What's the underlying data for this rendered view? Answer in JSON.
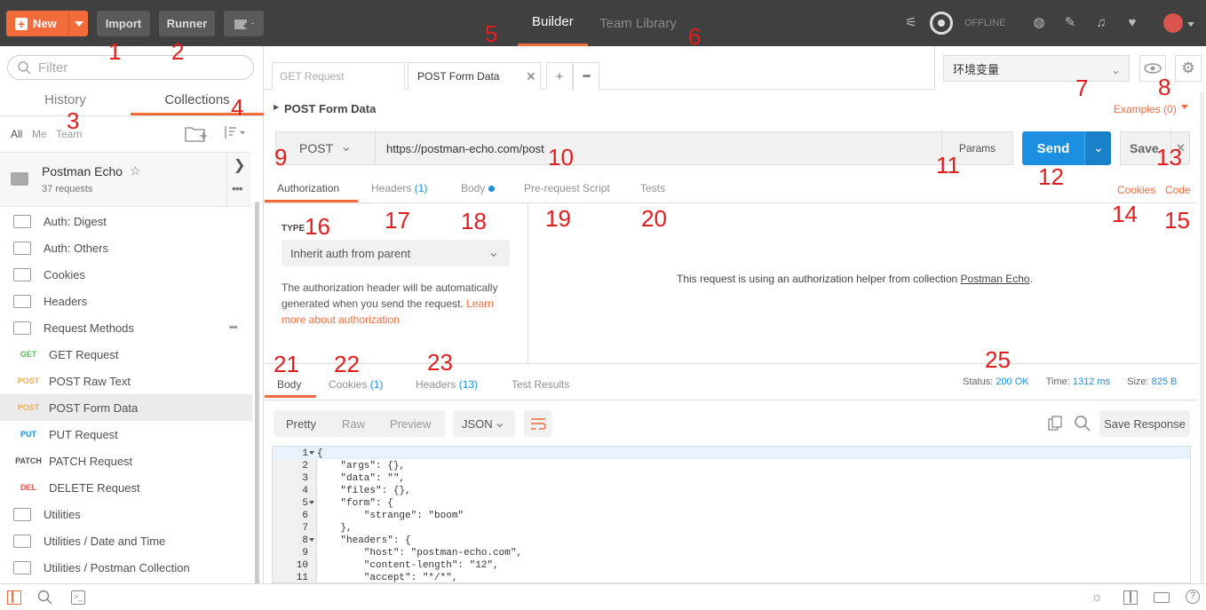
{
  "topbar": {
    "new_label": "New",
    "import_label": "Import",
    "runner_label": "Runner",
    "tabs": [
      "Builder",
      "Team Library"
    ],
    "offline_label": "OFFLINE"
  },
  "sidebar": {
    "filter_placeholder": "Filter",
    "tabs": [
      "History",
      "Collections"
    ],
    "filters": [
      "All",
      "Me",
      "Team"
    ],
    "collection": {
      "name": "Postman Echo",
      "count": "37 requests"
    },
    "items": [
      {
        "type": "folder",
        "label": "Auth: Digest"
      },
      {
        "type": "folder",
        "label": "Auth: Others"
      },
      {
        "type": "folder",
        "label": "Cookies"
      },
      {
        "type": "folder",
        "label": "Headers"
      },
      {
        "type": "folder-open",
        "label": "Request Methods"
      },
      {
        "type": "request",
        "method": "GET",
        "method_color": "#5cb85c",
        "label": "GET Request"
      },
      {
        "type": "request",
        "method": "POST",
        "method_color": "#f0ad4e",
        "label": "POST Raw Text"
      },
      {
        "type": "request",
        "method": "POST",
        "method_color": "#f0ad4e",
        "label": "POST Form Data"
      },
      {
        "type": "request",
        "method": "PUT",
        "method_color": "#1d8fe0",
        "label": "PUT Request"
      },
      {
        "type": "request",
        "method": "PATCH",
        "method_color": "#505050",
        "label": "PATCH Request"
      },
      {
        "type": "request",
        "method": "DEL",
        "method_color": "#d9534f",
        "label": "DELETE Request"
      },
      {
        "type": "folder",
        "label": "Utilities"
      },
      {
        "type": "folder",
        "label": "Utilities / Date and Time"
      },
      {
        "type": "folder",
        "label": "Utilities / Postman Collection"
      }
    ]
  },
  "request_tabs": [
    "GET Request",
    "POST Form Data"
  ],
  "environment": "环境变量",
  "request": {
    "name": "POST Form Data",
    "examples": "Examples (0)",
    "method": "POST",
    "url": "https://postman-echo.com/post",
    "params_label": "Params",
    "send_label": "Send",
    "save_label": "Save",
    "subtabs": [
      "Authorization",
      "Headers",
      "(1)",
      "Body",
      "Pre-request Script",
      "Tests"
    ],
    "cookies_link": "Cookies",
    "code_link": "Code"
  },
  "auth": {
    "type_label": "TYPE",
    "type_value": "Inherit auth from parent",
    "description": "The authorization header will be automatically generated when you send the request.",
    "learn_more": "Learn more about authorization",
    "helper_text": "This request is using an authorization helper from collection",
    "helper_link": "Postman Echo"
  },
  "response": {
    "tabs": [
      "Body",
      "Cookies",
      "(1)",
      "Headers",
      "(13)",
      "Test Results"
    ],
    "status_label": "Status:",
    "status_value": "200 OK",
    "time_label": "Time:",
    "time_value": "1312 ms",
    "size_label": "Size:",
    "size_value": "825 B",
    "view_modes": [
      "Pretty",
      "Raw",
      "Preview"
    ],
    "format": "JSON",
    "save_response_label": "Save Response",
    "code_lines": [
      {
        "n": "1",
        "fold": true,
        "text": "{"
      },
      {
        "n": "2",
        "fold": false,
        "text": "    \"args\": {},"
      },
      {
        "n": "3",
        "fold": false,
        "text": "    \"data\": \"\","
      },
      {
        "n": "4",
        "fold": false,
        "text": "    \"files\": {},"
      },
      {
        "n": "5",
        "fold": true,
        "text": "    \"form\": {"
      },
      {
        "n": "6",
        "fold": false,
        "text": "        \"strange\": \"boom\""
      },
      {
        "n": "7",
        "fold": false,
        "text": "    },"
      },
      {
        "n": "8",
        "fold": true,
        "text": "    \"headers\": {"
      },
      {
        "n": "9",
        "fold": false,
        "text": "        \"host\": \"postman-echo.com\","
      },
      {
        "n": "10",
        "fold": false,
        "text": "        \"content-length\": \"12\","
      },
      {
        "n": "11",
        "fold": false,
        "text": "        \"accept\": \"*/*\","
      }
    ]
  },
  "annotations": [
    "1",
    "2",
    "3",
    "4",
    "5",
    "6",
    "7",
    "8",
    "9",
    "10",
    "11",
    "12",
    "13",
    "14",
    "15",
    "16",
    "17",
    "18",
    "19",
    "20",
    "21",
    "22",
    "23",
    "25"
  ]
}
